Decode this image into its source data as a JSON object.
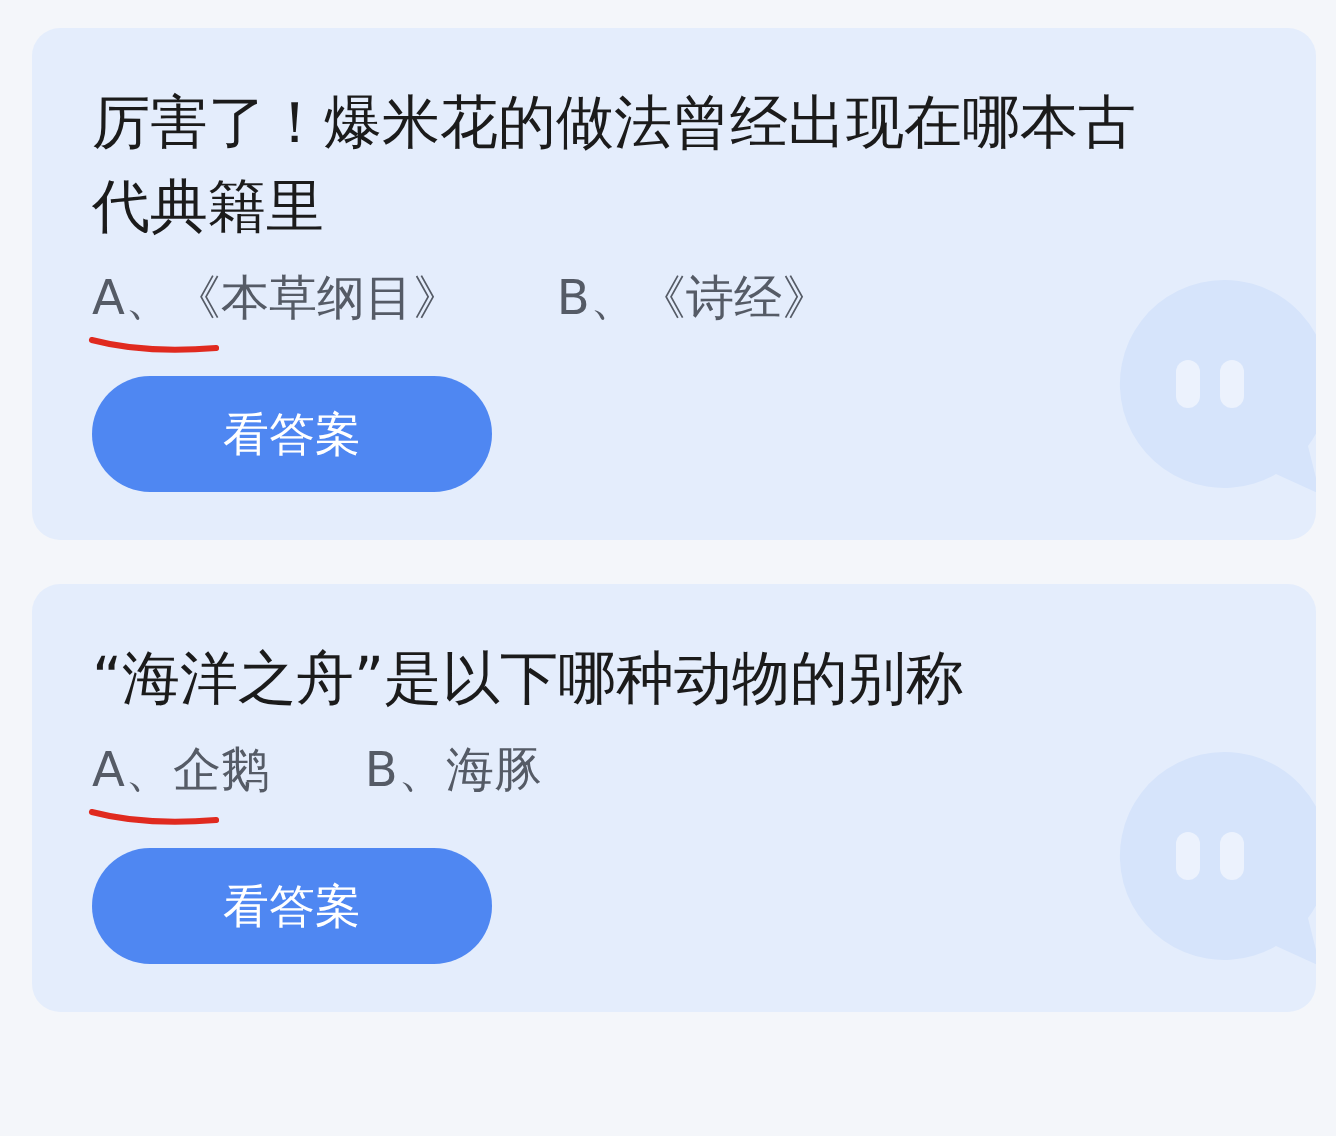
{
  "questions": [
    {
      "title": "厉害了！爆米花的做法曾经出现在哪本古代典籍里",
      "options": [
        {
          "label": "A、《本草纲目》",
          "marked": true
        },
        {
          "label": "B、《诗经》",
          "marked": false
        }
      ],
      "button": "看答案"
    },
    {
      "title": "“海洋之舟”是以下哪种动物的别称",
      "options": [
        {
          "label": "A、企鹅",
          "marked": true
        },
        {
          "label": "B、海豚",
          "marked": false
        }
      ],
      "button": "看答案"
    }
  ]
}
